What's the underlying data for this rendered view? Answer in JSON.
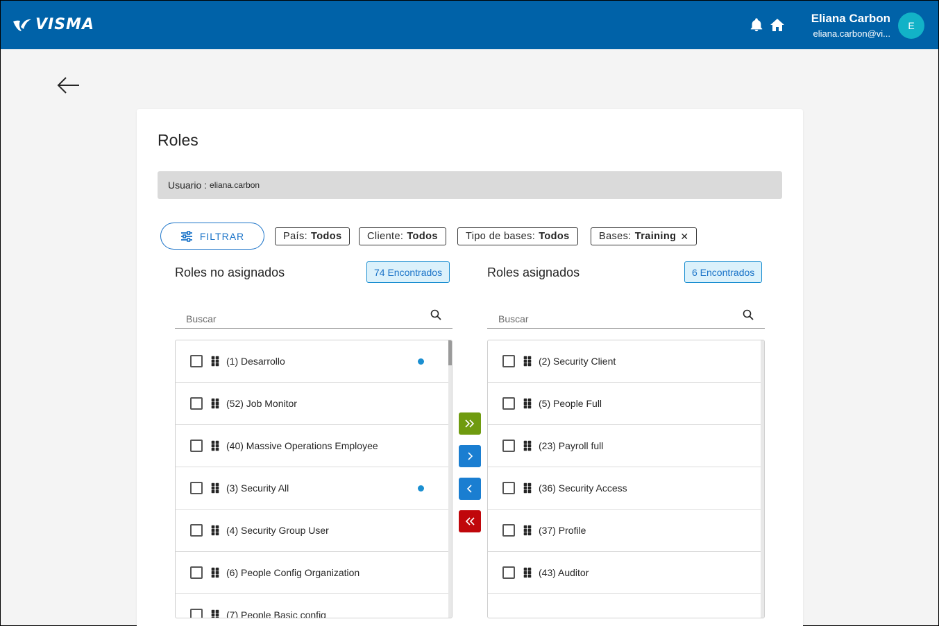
{
  "header": {
    "brand": "VISMA",
    "user_name": "Eliana Carbon",
    "user_email": "eliana.carbon@vi...",
    "avatar_initial": "E",
    "icons": [
      "bell-icon",
      "home-icon"
    ],
    "bar_color": "#0062a8"
  },
  "page": {
    "title": "Roles",
    "user_label": "Usuario :",
    "user_value": "eliana.carbon"
  },
  "filters": {
    "button_label": "FILTRAR",
    "chips": [
      {
        "key": "País:",
        "value": "Todos",
        "removable": false
      },
      {
        "key": "Cliente:",
        "value": "Todos",
        "removable": false
      },
      {
        "key": "Tipo de bases:",
        "value": "Todos",
        "removable": false
      },
      {
        "key": "Bases:",
        "value": "Training",
        "removable": true,
        "remove_glyph": "✕"
      }
    ]
  },
  "unassigned": {
    "title": "Roles no asignados",
    "found": "74 Encontrados",
    "search_placeholder": "Buscar",
    "items": [
      {
        "label": "(1) Desarrollo",
        "flag": true
      },
      {
        "label": "(52) Job Monitor",
        "flag": false
      },
      {
        "label": "(40) Massive Operations Employee",
        "flag": false
      },
      {
        "label": "(3) Security All",
        "flag": true
      },
      {
        "label": "(4) Security Group User",
        "flag": false
      },
      {
        "label": "(6) People Config Organization",
        "flag": false
      },
      {
        "label": "(7) People Basic config",
        "flag": false
      }
    ]
  },
  "assigned": {
    "title": "Roles asignados",
    "found": "6 Encontrados",
    "search_placeholder": "Buscar",
    "items": [
      {
        "label": "(2) Security Client"
      },
      {
        "label": "(5) People Full"
      },
      {
        "label": "(23) Payroll full"
      },
      {
        "label": "(36) Security Access"
      },
      {
        "label": "(37) Profile"
      },
      {
        "label": "(43) Auditor"
      }
    ]
  },
  "transfer": {
    "move_all_right": {
      "glyph": "»",
      "color": "#6f9b0f"
    },
    "move_right": {
      "glyph": "›",
      "color": "#1a7ed1"
    },
    "move_left": {
      "glyph": "‹",
      "color": "#1a7ed1"
    },
    "move_all_left": {
      "glyph": "«",
      "color": "#c0070b"
    }
  }
}
